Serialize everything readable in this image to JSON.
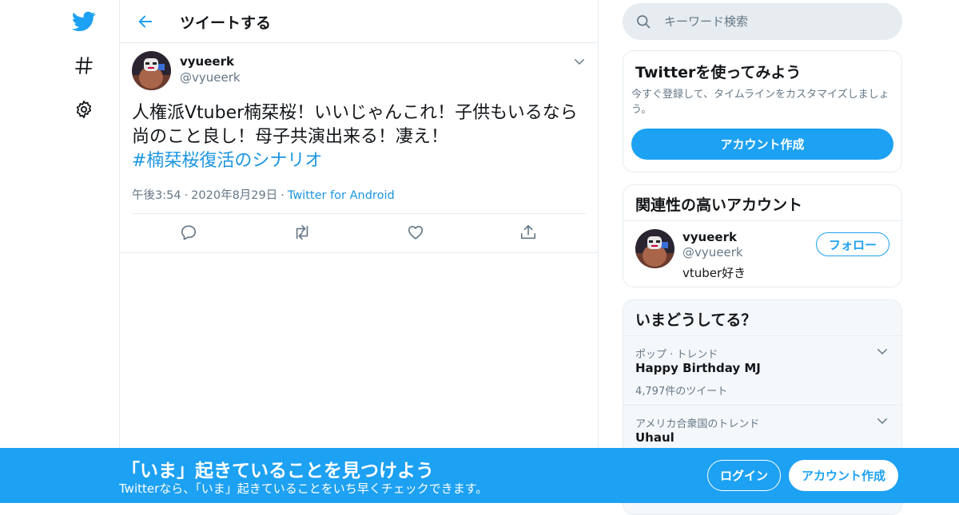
{
  "colors": {
    "accent": "#1da1f2",
    "link": "#1b95e0",
    "secondary_text": "#657786",
    "border": "#e6ecf0"
  },
  "nav": {
    "items": [
      {
        "icon": "twitter-bird-icon"
      },
      {
        "icon": "hashtag-icon"
      },
      {
        "icon": "gear-icon"
      }
    ]
  },
  "header": {
    "title": "ツイートする",
    "back_icon": "arrow-left-icon"
  },
  "tweet": {
    "author_name": "vyueerk",
    "author_handle": "@vyueerk",
    "text": "人権派Vtuber楠栞桜！いいじゃんこれ！子供もいるなら尚のこと良し！母子共演出来る！凄え！",
    "hashtag": "#楠栞桜復活のシナリオ",
    "time": "午後3:54",
    "date": "2020年8月29日",
    "separator": "·",
    "source": "Twitter for Android",
    "actions": [
      "reply-icon",
      "retweet-icon",
      "like-icon",
      "share-icon"
    ]
  },
  "search": {
    "placeholder": "キーワード検索"
  },
  "signup_card": {
    "title": "Twitterを使ってみよう",
    "description": "今すぐ登録して、タイムラインをカスタマイズしましょう。",
    "button": "アカウント作成"
  },
  "related": {
    "title": "関連性の高いアカウント",
    "name": "vyueerk",
    "handle": "@vyueerk",
    "bio": "vtuber好き",
    "follow_label": "フォロー"
  },
  "trends": {
    "title": "いまどうしてる？",
    "items": [
      {
        "context": "ポップ · トレンド",
        "name": "Happy Birthday MJ",
        "count": "4,797件のツイート"
      },
      {
        "context": "アメリカ合衆国のトレンド",
        "name": "Uhaul",
        "count": ""
      }
    ]
  },
  "bottom_bar": {
    "title": "「いま」起きていることを見つけよう",
    "subtitle": "Twitterなら、「いま」起きていることをいち早くチェックできます。",
    "login": "ログイン",
    "signup": "アカウント作成"
  }
}
